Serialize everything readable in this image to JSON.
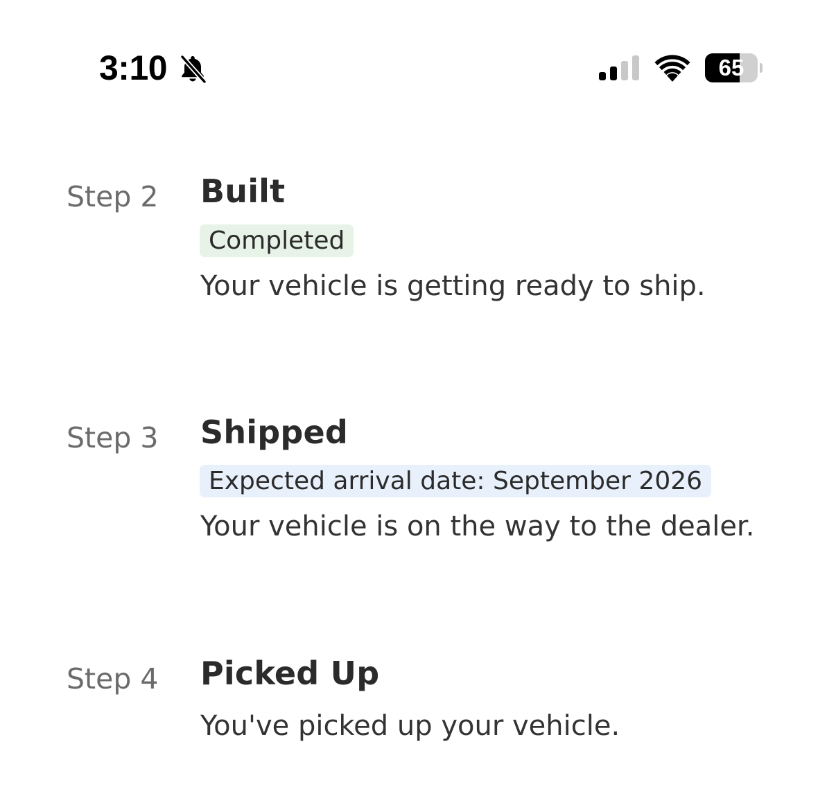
{
  "status_bar": {
    "time": "3:10",
    "battery_level": "65",
    "icons": [
      "bell-slash-icon",
      "cellular-signal-icon",
      "wifi-icon",
      "battery-icon"
    ]
  },
  "steps": [
    {
      "label": "Step 2",
      "title": "Built",
      "badge": "Completed",
      "badge_color": "#e7f3e6",
      "description": "Your vehicle is getting ready to ship."
    },
    {
      "label": "Step 3",
      "title": "Shipped",
      "badge": "Expected arrival date: September 2026",
      "badge_color": "#e8f0fb",
      "description": "Your vehicle is on the way to the dealer."
    },
    {
      "label": "Step 4",
      "title": "Picked Up",
      "description": "You've picked up your vehicle."
    }
  ]
}
